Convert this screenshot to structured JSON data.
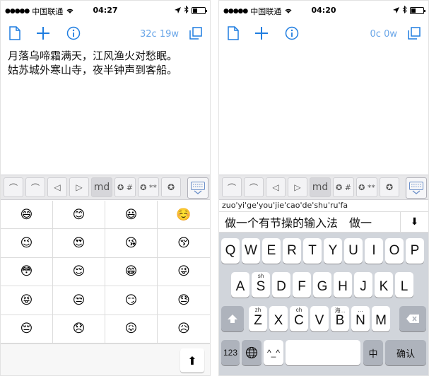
{
  "left": {
    "status": {
      "carrier": "中国联通",
      "time": "04:27"
    },
    "toolbar": {
      "count": "32c 19w"
    },
    "editor": {
      "lines": [
        "月落乌啼霜满天，江风渔火对愁眠。",
        "姑苏城外寒山寺，夜半钟声到客船。"
      ]
    },
    "shortcuts": [
      "⌒",
      "⌒",
      "◁",
      "▷",
      "md",
      "✪ #",
      "✪ **",
      "✪"
    ],
    "emoji": [
      "😄",
      "😊",
      "😃",
      "☺️",
      "😉",
      "😍",
      "😘",
      "😚",
      "😳",
      "😌",
      "😁",
      "😜",
      "😝",
      "😒",
      "😏",
      "😓",
      "😔",
      "😞",
      "😖",
      "😥"
    ],
    "up_key": "⬆"
  },
  "right": {
    "status": {
      "carrier": "中国联通",
      "time": "04:20"
    },
    "toolbar": {
      "count": "0c 0w"
    },
    "shortcuts": [
      "⌒",
      "⌒",
      "◁",
      "▷",
      "md",
      "✪ #",
      "✪ **",
      "✪"
    ],
    "pinyin": "zuo'yi'ge'you'jie'cao'de'shu'ru'fa",
    "candidates": [
      "做一个有节操的输入法",
      "做一"
    ],
    "candidates_more": "⬇",
    "keys": {
      "row1": [
        "Q",
        "W",
        "E",
        "R",
        "T",
        "Y",
        "U",
        "I",
        "O",
        "P"
      ],
      "row2": [
        {
          "label": "A",
          "hint": ""
        },
        {
          "label": "S",
          "hint": "sh"
        },
        {
          "label": "D",
          "hint": ""
        },
        {
          "label": "F",
          "hint": ""
        },
        {
          "label": "G",
          "hint": ""
        },
        {
          "label": "H",
          "hint": ""
        },
        {
          "label": "J",
          "hint": ""
        },
        {
          "label": "K",
          "hint": ""
        },
        {
          "label": "L",
          "hint": ""
        }
      ],
      "row3": [
        {
          "label": "Z",
          "hint": "zh"
        },
        {
          "label": "X",
          "hint": ""
        },
        {
          "label": "C",
          "hint": "ch"
        },
        {
          "label": "V",
          "hint": ""
        },
        {
          "label": "B",
          "hint": "海..."
        },
        {
          "label": "N",
          "hint": "…"
        },
        {
          "label": "M",
          "hint": ""
        }
      ],
      "numbers": "123",
      "emoticon": "^_^",
      "lang": "中",
      "confirm": "确认"
    }
  },
  "colors": {
    "accent": "#1f7de0",
    "keyboard_bg": "#d1d5db"
  }
}
